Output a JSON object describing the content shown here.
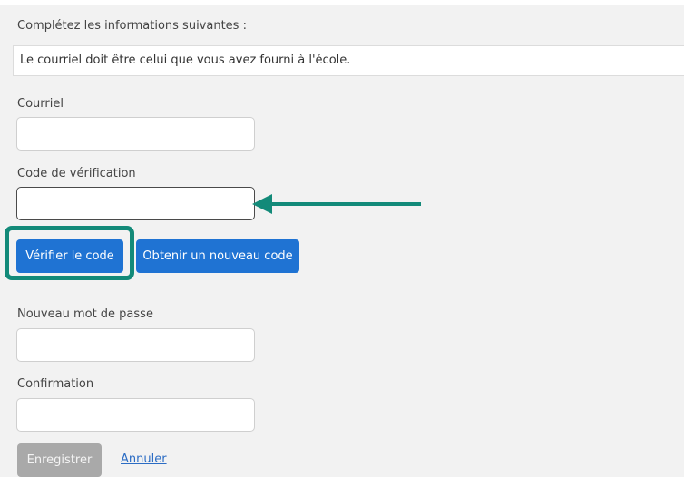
{
  "form": {
    "intro": "Complétez les informations suivantes :",
    "notice": "Le courriel doit être celui que vous avez fourni à l'école.",
    "email": {
      "label": "Courriel",
      "value": "",
      "placeholder": ""
    },
    "code": {
      "label": "Code de vérification",
      "value": "",
      "placeholder": ""
    },
    "verify_button": "Vérifier le code",
    "new_code_button": "Obtenir un nouveau code",
    "new_password": {
      "label": "Nouveau mot de passe",
      "value": ""
    },
    "confirmation": {
      "label": "Confirmation",
      "value": ""
    },
    "save_button": "Enregistrer",
    "cancel_link": "Annuler"
  },
  "annotations": {
    "accent_color": "#138a79",
    "highlight_target": "verify-code-button",
    "arrow_target": "verification-code-input"
  },
  "colors": {
    "primary_button": "#1f73d3",
    "disabled_button": "#a9a9a9",
    "link": "#2b6cc4",
    "background": "#f2f2f2"
  }
}
